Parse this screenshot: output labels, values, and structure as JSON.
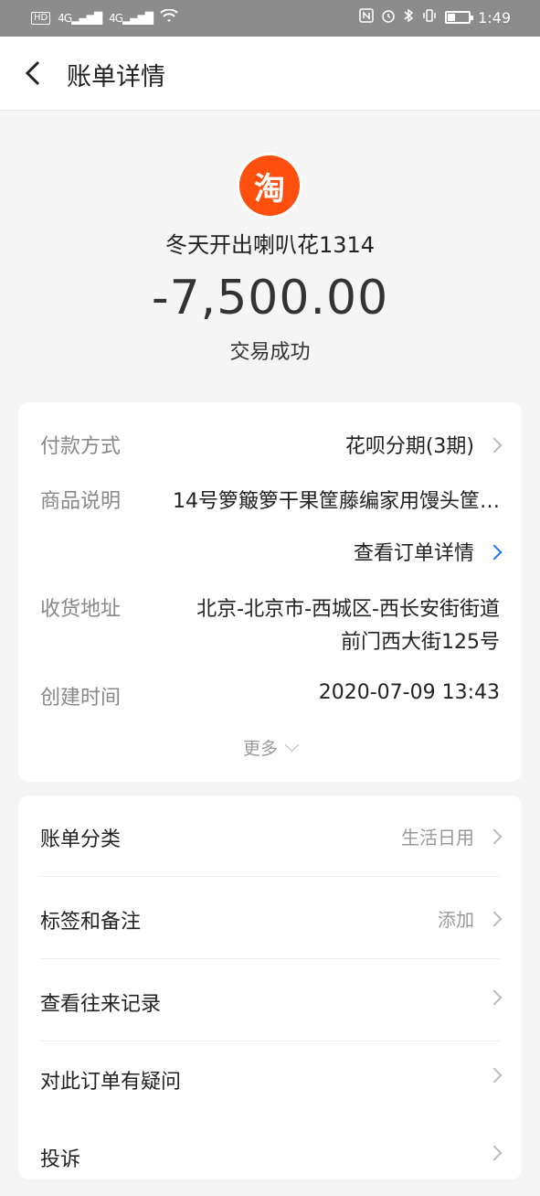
{
  "status_bar": {
    "chip_hd": "HD",
    "net1": "4G",
    "net2": "4G",
    "time": "1:49"
  },
  "header": {
    "title": "账单详情"
  },
  "summary": {
    "logo_char": "淘",
    "merchant": "冬天开出喇叭花1314",
    "amount": "-7,500.00",
    "status": "交易成功"
  },
  "details": {
    "payment_label": "付款方式",
    "payment_value": "花呗分期(3期)",
    "product_label": "商品说明",
    "product_value": "14号箩簸箩干果筐藤编家用馒头筐…",
    "order_link": "查看订单详情",
    "address_label": "收货地址",
    "address_line1": "北京-北京市-西城区-西长安街街道",
    "address_line2": "前门西大街125号",
    "created_label": "创建时间",
    "created_value": "2020-07-09 13:43",
    "more": "更多"
  },
  "menu": {
    "category_label": "账单分类",
    "category_value": "生活日用",
    "tags_label": "标签和备注",
    "tags_value": "添加",
    "history_label": "查看往来记录",
    "question_label": "对此订单有疑问",
    "complaint_label": "投诉"
  },
  "colors": {
    "accent": "#1677ff",
    "taobao": "#ff4f0f"
  }
}
